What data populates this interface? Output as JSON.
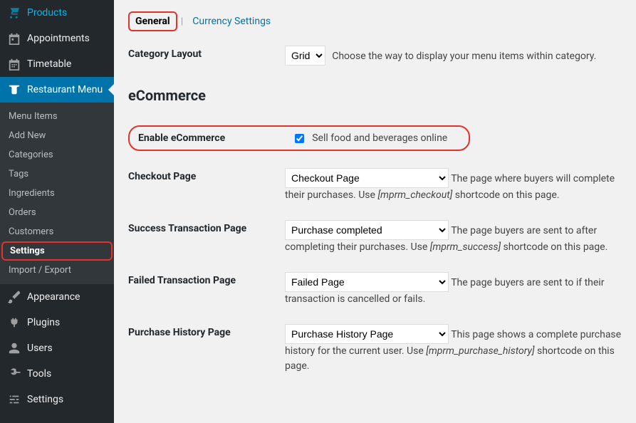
{
  "sidebar": {
    "items": [
      {
        "label": "Products"
      },
      {
        "label": "Appointments"
      },
      {
        "label": "Timetable"
      },
      {
        "label": "Restaurant Menu"
      },
      {
        "label": "Appearance"
      },
      {
        "label": "Plugins"
      },
      {
        "label": "Users"
      },
      {
        "label": "Tools"
      },
      {
        "label": "Settings"
      }
    ],
    "submenu": [
      {
        "label": "Menu Items"
      },
      {
        "label": "Add New"
      },
      {
        "label": "Categories"
      },
      {
        "label": "Tags"
      },
      {
        "label": "Ingredients"
      },
      {
        "label": "Orders"
      },
      {
        "label": "Customers"
      },
      {
        "label": "Settings"
      },
      {
        "label": "Import / Export"
      }
    ]
  },
  "tabs": {
    "general": "General",
    "currency": "Currency Settings"
  },
  "form": {
    "category_layout": {
      "label": "Category Layout",
      "selected": "Grid",
      "desc": "Choose the way to display your menu items within category."
    },
    "ecommerce_heading": "eCommerce",
    "enable_ecommerce": {
      "label": "Enable eCommerce",
      "checkbox_label": "Sell food and beverages online"
    },
    "checkout_page": {
      "label": "Checkout Page",
      "selected": "Checkout Page",
      "desc_before": "The page where buyers will complete their purchases. Use ",
      "shortcode": "[mprm_checkout]",
      "desc_after": " shortcode on this page."
    },
    "success_page": {
      "label": "Success Transaction Page",
      "selected": "Purchase completed",
      "desc_before": "The page buyers are sent to after completing their purchases. Use ",
      "shortcode": "[mprm_success]",
      "desc_after": " shortcode on this page."
    },
    "failed_page": {
      "label": "Failed Transaction Page",
      "selected": "Failed Page",
      "desc_before": "The page buyers are sent to if their transaction is cancelled or fails."
    },
    "history_page": {
      "label": "Purchase History Page",
      "selected": "Purchase History Page",
      "desc_before": "This page shows a complete purchase history for the current user. Use ",
      "shortcode": "[mprm_purchase_history]",
      "desc_after": " shortcode on this page."
    }
  }
}
